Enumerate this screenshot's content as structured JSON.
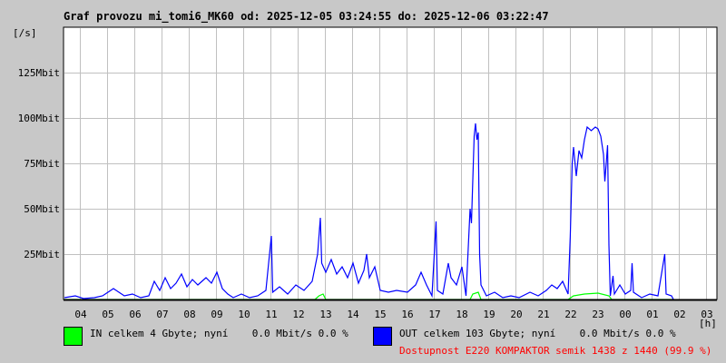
{
  "title": "Graf provozu mi_tomi6_MK60 od: 2025-12-05 03:24:55 do: 2025-12-06 03:22:47",
  "unit_label": "[/s]",
  "hour_unit": "[h]",
  "legend": {
    "in": {
      "text": "IN celkem 4 Gbyte; nyní    0.0 Mbit/s 0.0 %",
      "color": "#00ff00"
    },
    "out": {
      "text": "OUT celkem 103 Gbyte; nyní    0.0 Mbit/s 0.0 %",
      "color": "#0000ff"
    },
    "availability": "Dostupnost E220 KOMPAKTOR semik 1438 z 1440 (99.9 %)",
    "availability_color": "#ff0000"
  },
  "chart_data": {
    "type": "line",
    "ylabel": "[/s]",
    "xlabel": "[h]",
    "y_ticks": [
      "25Mbit",
      "50Mbit",
      "75Mbit",
      "100Mbit",
      "125Mbit"
    ],
    "y_tick_values": [
      25,
      50,
      75,
      100,
      125
    ],
    "ylim": [
      0,
      150
    ],
    "x_ticks": [
      "04",
      "05",
      "06",
      "07",
      "08",
      "09",
      "10",
      "11",
      "12",
      "13",
      "14",
      "15",
      "16",
      "17",
      "18",
      "19",
      "20",
      "21",
      "22",
      "23",
      "00",
      "01",
      "02",
      "03"
    ],
    "xlim_hours": [
      3.37,
      27.37
    ],
    "grid": true,
    "series": [
      {
        "name": "OUT",
        "color": "#0000ff",
        "points": [
          [
            3.4,
            1
          ],
          [
            3.8,
            2
          ],
          [
            4.1,
            0.5
          ],
          [
            4.5,
            1
          ],
          [
            4.8,
            2
          ],
          [
            5.0,
            4
          ],
          [
            5.2,
            6
          ],
          [
            5.4,
            4
          ],
          [
            5.6,
            2
          ],
          [
            5.9,
            3
          ],
          [
            6.2,
            1
          ],
          [
            6.5,
            2
          ],
          [
            6.7,
            10
          ],
          [
            6.9,
            5
          ],
          [
            7.1,
            12
          ],
          [
            7.3,
            6
          ],
          [
            7.5,
            9
          ],
          [
            7.7,
            14
          ],
          [
            7.9,
            7
          ],
          [
            8.1,
            11
          ],
          [
            8.3,
            8
          ],
          [
            8.6,
            12
          ],
          [
            8.8,
            9
          ],
          [
            9.0,
            15
          ],
          [
            9.2,
            6
          ],
          [
            9.4,
            3
          ],
          [
            9.6,
            1
          ],
          [
            9.9,
            3
          ],
          [
            10.2,
            1
          ],
          [
            10.5,
            2
          ],
          [
            10.8,
            5
          ],
          [
            11.0,
            35
          ],
          [
            11.05,
            4
          ],
          [
            11.3,
            7
          ],
          [
            11.6,
            3
          ],
          [
            11.9,
            8
          ],
          [
            12.2,
            5
          ],
          [
            12.5,
            10
          ],
          [
            12.7,
            25
          ],
          [
            12.8,
            45
          ],
          [
            12.85,
            20
          ],
          [
            13.0,
            15
          ],
          [
            13.2,
            22
          ],
          [
            13.4,
            14
          ],
          [
            13.6,
            18
          ],
          [
            13.8,
            12
          ],
          [
            14.0,
            20
          ],
          [
            14.2,
            9
          ],
          [
            14.4,
            16
          ],
          [
            14.5,
            25
          ],
          [
            14.6,
            12
          ],
          [
            14.8,
            18
          ],
          [
            15.0,
            5
          ],
          [
            15.3,
            4
          ],
          [
            15.6,
            5
          ],
          [
            16.0,
            4
          ],
          [
            16.3,
            8
          ],
          [
            16.5,
            15
          ],
          [
            16.7,
            8
          ],
          [
            16.9,
            2
          ],
          [
            17.05,
            43
          ],
          [
            17.1,
            5
          ],
          [
            17.3,
            3
          ],
          [
            17.5,
            20
          ],
          [
            17.6,
            12
          ],
          [
            17.8,
            8
          ],
          [
            18.0,
            18
          ],
          [
            18.15,
            2
          ],
          [
            18.3,
            50
          ],
          [
            18.35,
            42
          ],
          [
            18.45,
            90
          ],
          [
            18.5,
            97
          ],
          [
            18.55,
            88
          ],
          [
            18.6,
            92
          ],
          [
            18.65,
            25
          ],
          [
            18.7,
            8
          ],
          [
            18.9,
            2
          ],
          [
            19.2,
            4
          ],
          [
            19.5,
            1
          ],
          [
            19.8,
            2
          ],
          [
            20.1,
            1
          ],
          [
            20.5,
            4
          ],
          [
            20.8,
            2
          ],
          [
            21.1,
            5
          ],
          [
            21.3,
            8
          ],
          [
            21.5,
            6
          ],
          [
            21.7,
            10
          ],
          [
            21.9,
            3
          ],
          [
            21.98,
            35
          ],
          [
            22.05,
            75
          ],
          [
            22.1,
            84
          ],
          [
            22.2,
            68
          ],
          [
            22.3,
            82
          ],
          [
            22.4,
            78
          ],
          [
            22.5,
            88
          ],
          [
            22.6,
            95
          ],
          [
            22.75,
            93
          ],
          [
            22.9,
            95
          ],
          [
            23.0,
            94
          ],
          [
            23.1,
            90
          ],
          [
            23.2,
            80
          ],
          [
            23.25,
            65
          ],
          [
            23.35,
            85
          ],
          [
            23.4,
            30
          ],
          [
            23.45,
            2
          ],
          [
            23.55,
            13
          ],
          [
            23.6,
            3
          ],
          [
            23.8,
            8
          ],
          [
            24.0,
            3
          ],
          [
            24.2,
            5
          ],
          [
            24.25,
            20
          ],
          [
            24.3,
            4
          ],
          [
            24.6,
            1
          ],
          [
            24.9,
            3
          ],
          [
            25.2,
            2
          ],
          [
            25.45,
            25
          ],
          [
            25.5,
            3
          ],
          [
            25.7,
            2
          ],
          [
            25.77,
            0
          ]
        ]
      },
      {
        "name": "IN",
        "color": "#00ff00",
        "points": [
          [
            3.4,
            0
          ],
          [
            12.6,
            0
          ],
          [
            12.75,
            2
          ],
          [
            12.9,
            3
          ],
          [
            13.0,
            0
          ],
          [
            18.3,
            0
          ],
          [
            18.4,
            3
          ],
          [
            18.6,
            4
          ],
          [
            18.7,
            0
          ],
          [
            21.9,
            0
          ],
          [
            22.1,
            2
          ],
          [
            22.5,
            3
          ],
          [
            23.0,
            3.5
          ],
          [
            23.4,
            2
          ],
          [
            23.5,
            0
          ],
          [
            25.77,
            0
          ]
        ]
      }
    ]
  }
}
